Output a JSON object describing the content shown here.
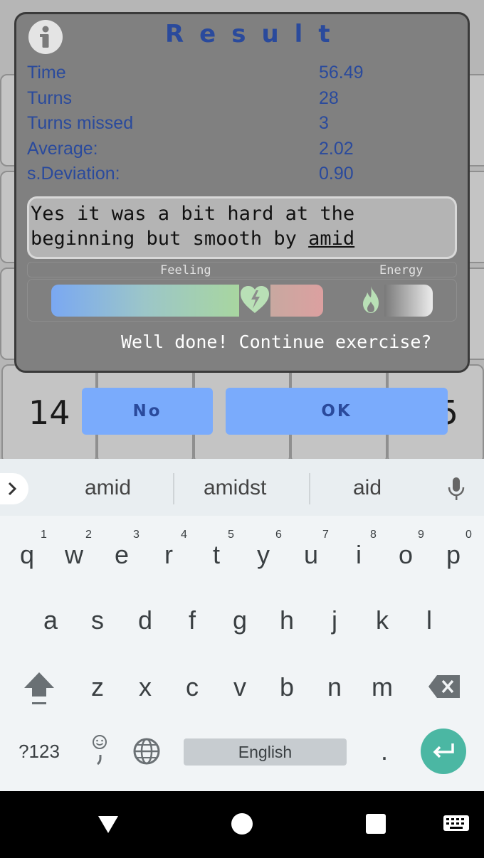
{
  "dialog": {
    "title": "Result",
    "stats": [
      {
        "label": "Time",
        "value": "56.49"
      },
      {
        "label": "Turns",
        "value": "28"
      },
      {
        "label": "Turns missed",
        "value": "3"
      },
      {
        "label": "Average:",
        "value": "2.02"
      },
      {
        "label": "s.Deviation:",
        "value": "0.90"
      }
    ],
    "comment_before": "Yes it was a bit hard at the beginning but smooth by ",
    "comment_word": "amid",
    "feeling_label": "Feeling",
    "energy_label": "Energy",
    "prompt": "Well done! Continue exercise?",
    "no_label": "No",
    "ok_label": "OK"
  },
  "board": {
    "visible_numbers": [
      "14",
      "5"
    ]
  },
  "keyboard": {
    "suggestions": [
      "amid",
      "amidst",
      "aid"
    ],
    "row1": [
      "q",
      "w",
      "e",
      "r",
      "t",
      "y",
      "u",
      "i",
      "o",
      "p"
    ],
    "row1_hints": [
      "1",
      "2",
      "3",
      "4",
      "5",
      "6",
      "7",
      "8",
      "9",
      "0"
    ],
    "row2": [
      "a",
      "s",
      "d",
      "f",
      "g",
      "h",
      "j",
      "k",
      "l"
    ],
    "row3": [
      "z",
      "x",
      "c",
      "v",
      "b",
      "n",
      "m"
    ],
    "symbols_label": "?123",
    "space_label": "English",
    "period_label": "."
  },
  "colors": {
    "accent_blue": "#2a4a9c",
    "button_blue": "#7aabfc",
    "enter_teal": "#4bb7a3"
  }
}
